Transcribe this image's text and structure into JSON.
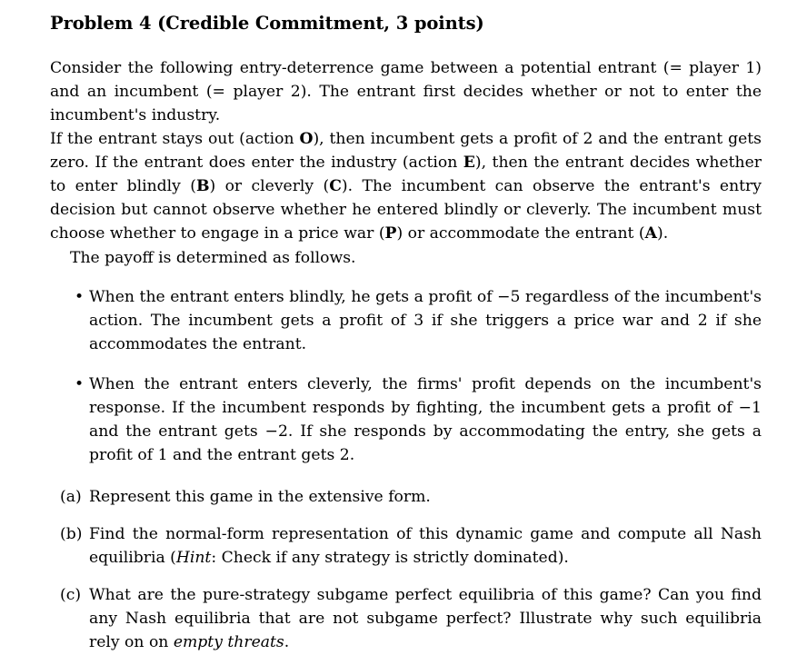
{
  "document": {
    "title": "Problem 4 (Credible Commitment, 3 points)",
    "background_color": "#ffffff",
    "text_color": "#000000",
    "paragraphs": {
      "intro_1": "Consider the following entry-deterrence game between a potential entrant (= player 1) and an incumbent (= player 2). The entrant first decides whether or not to enter the incumbent's industry.",
      "intro_2_a": "If the entrant stays out (action ",
      "intro_2_o": "O",
      "intro_2_b": "), then incumbent gets a profit of 2 and the entrant gets zero. If the entrant does enter the industry (action ",
      "intro_2_e": "E",
      "intro_2_c": "), then the entrant decides whether to enter blindly (",
      "intro_2_bl": "B",
      "intro_2_d": ") or cleverly (",
      "intro_2_cl": "C",
      "intro_2_e2": "). The incumbent can observe the entrant's entry decision but cannot observe whether he entered blindly or cleverly.  The incumbent must choose whether to engage in a price war (",
      "intro_2_p": "P",
      "intro_2_f": ") or accommodate the entrant (",
      "intro_2_acc": "A",
      "intro_2_g": ").",
      "payoff_lead": "The payoff is determined as follows."
    },
    "payoff_bullets": [
      {
        "marker": "•",
        "text": "When the entrant enters blindly, he gets a profit of −5 regardless of the incumbent's action. The incumbent gets a profit of 3 if she triggers a price war and 2 if she accommodates the entrant."
      },
      {
        "marker": "•",
        "text": "When the entrant enters cleverly, the firms' profit depends on the incumbent's response. If the incumbent responds by fighting, the incumbent gets a profit of −1 and the entrant gets −2. If she responds by accommodating the entry, she gets a profit of 1 and the entrant gets 2."
      }
    ],
    "questions": [
      {
        "marker": "(a)",
        "text": "Represent this game in the extensive form."
      },
      {
        "marker": "(b)",
        "text_before_hint": "Find the normal-form representation of this dynamic game and compute all Nash equilibria (",
        "hint_label": "Hint",
        "text_after_hint": ": Check if any strategy is strictly dominated)."
      },
      {
        "marker": "(c)",
        "text_before_emph": "What are the pure-strategy subgame perfect equilibria of this game? Can you find any Nash equilibria that are not subgame perfect?  Illustrate why such equilibria rely on on ",
        "emph_text": "empty threats",
        "text_after_emph": "."
      }
    ]
  }
}
